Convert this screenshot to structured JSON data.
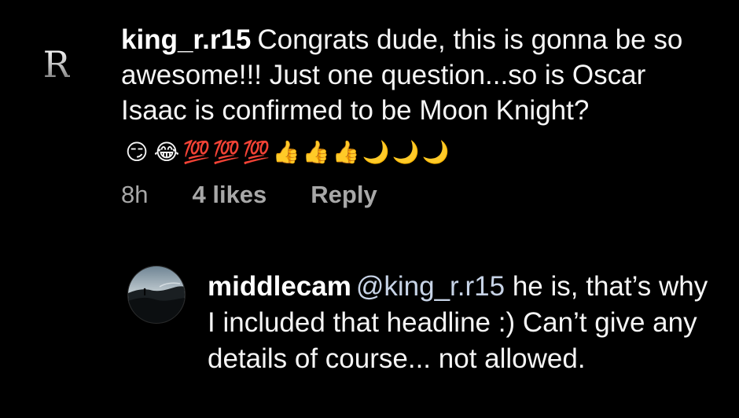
{
  "comments": [
    {
      "username": "king_r.r15",
      "text": "Congrats dude, this is gonna be so awesome!!! Just one question...so is Oscar Isaac is confirmed to be Moon Knight?",
      "emojis": [
        "😏",
        "😂",
        "💯",
        "💯",
        "💯",
        "👍",
        "👍",
        "👍",
        "🌙",
        "🌙",
        "🌙"
      ],
      "avatar_letter": "R",
      "time": "8h",
      "likes": "4 likes",
      "reply_label": "Reply"
    }
  ],
  "reply": {
    "username": "middlecam",
    "mention": "@king_r.r15",
    "text": "he is, that’s why I included that headline :) Can’t give any details of course... not allowed."
  },
  "colors": {
    "background": "#000000",
    "text": "#f5f5f5",
    "meta": "#a8a8a8",
    "mention": "#c7d3e6"
  }
}
